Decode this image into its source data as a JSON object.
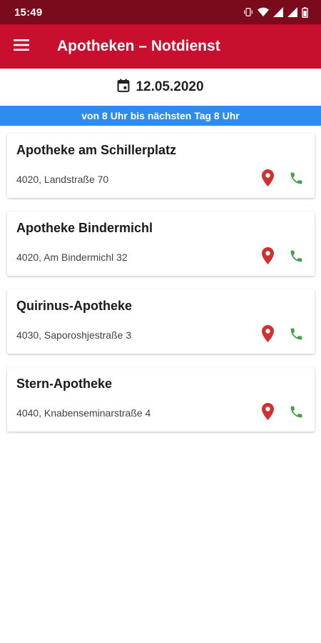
{
  "status_bar": {
    "time": "15:49",
    "icons": [
      "vibrate-icon",
      "wifi-icon",
      "signal-icon",
      "signal-icon",
      "battery-icon"
    ]
  },
  "app_bar": {
    "menu_icon": "hamburger-menu-icon",
    "title": "Apotheken – Notdienst"
  },
  "date": {
    "icon": "calendar-icon",
    "value": "12.05.2020"
  },
  "hours_banner": "von 8 Uhr bis nächsten Tag 8 Uhr",
  "pharmacies": [
    {
      "name": "Apotheke am Schillerplatz",
      "address": "4020, Landstraße 70"
    },
    {
      "name": "Apotheke Bindermichl",
      "address": "4020, Am Bindermichl 32"
    },
    {
      "name": "Quirinus-Apotheke",
      "address": "4030, Saporoshjestraße 3"
    },
    {
      "name": "Stern-Apotheke",
      "address": "4040, Knabenseminarstraße 4"
    }
  ],
  "colors": {
    "status_bar": "#7a0b1c",
    "app_bar": "#c8102e",
    "banner": "#2d8cf0",
    "map_icon": "#d32f2f",
    "phone_icon": "#43a047"
  }
}
